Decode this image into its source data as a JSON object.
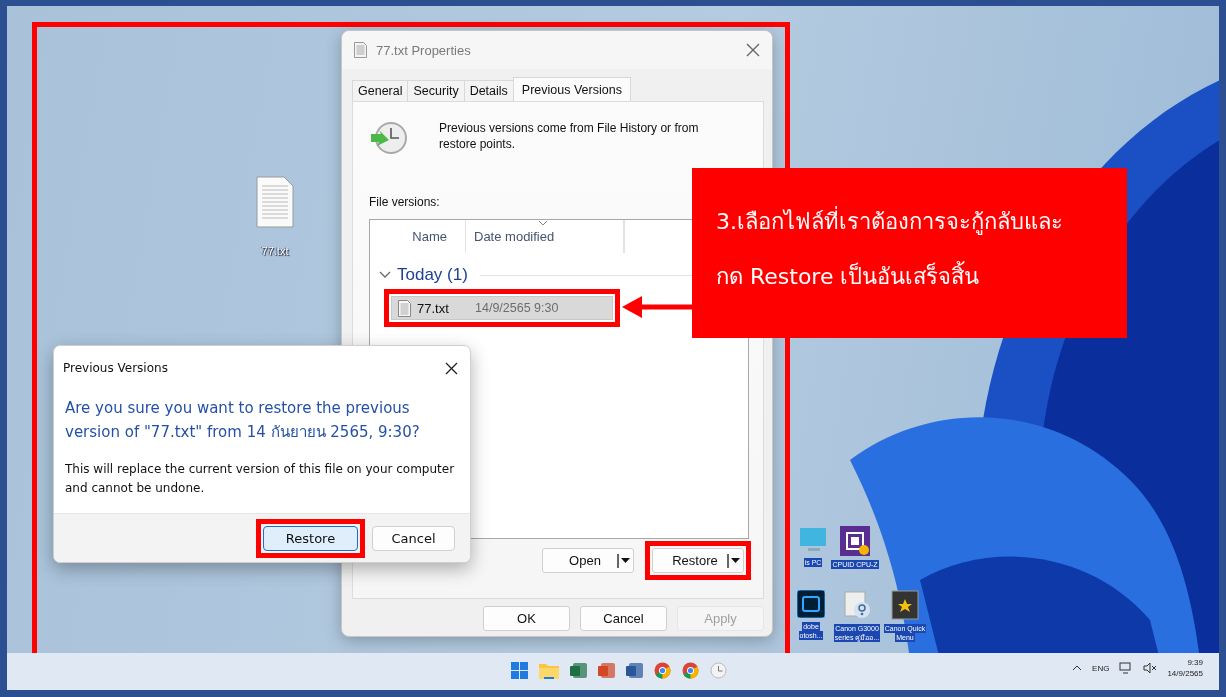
{
  "desktop": {
    "icons": [
      {
        "kind": "text-file",
        "lines": [
          "77.txt"
        ]
      },
      {
        "kind": "monitor",
        "lines": [
          "is PC"
        ]
      },
      {
        "kind": "cpu-app",
        "lines": [
          "CPUID CPU-Z"
        ]
      },
      {
        "kind": "ps-app",
        "lines": [
          "dobe",
          "otosh..."
        ]
      },
      {
        "kind": "help-app",
        "lines": [
          "Canon G3000",
          "series คู่มืออ..."
        ]
      },
      {
        "kind": "canon-app",
        "lines": [
          "Canon Quick",
          "Menu"
        ]
      }
    ]
  },
  "properties_window": {
    "title": "77.txt Properties",
    "tabs": [
      {
        "label": "General",
        "selected": false
      },
      {
        "label": "Security",
        "selected": false
      },
      {
        "label": "Details",
        "selected": false
      },
      {
        "label": "Previous Versions",
        "selected": true
      }
    ],
    "info": "Previous versions come from File History or from restore points.",
    "list_label": "File versions:",
    "columns": [
      {
        "label": "Name",
        "sorted": false
      },
      {
        "label": "Date modified",
        "sorted": true
      }
    ],
    "group": {
      "label": "Today (1)",
      "expanded": true,
      "rows": [
        {
          "name": "77.txt",
          "date": "14/9/2565 9:30",
          "selected": true,
          "highlighted": true
        }
      ]
    },
    "split_buttons": [
      {
        "label": "Open",
        "highlighted": false
      },
      {
        "label": "Restore",
        "highlighted": true
      }
    ],
    "buttons": [
      {
        "label": "OK",
        "disabled": false
      },
      {
        "label": "Cancel",
        "disabled": false
      },
      {
        "label": "Apply",
        "disabled": true
      }
    ]
  },
  "confirm_dialog": {
    "title": "Previous Versions",
    "question": "Are you sure you want to restore the previous version of \"77.txt\" from 14 กันยายน 2565, 9:30?",
    "detail": "This will replace the current version of this file on your computer and cannot be undone.",
    "buttons": [
      {
        "label": "Restore",
        "default": true,
        "highlighted": true
      },
      {
        "label": "Cancel",
        "default": false,
        "highlighted": false
      }
    ]
  },
  "callout": {
    "lines": [
      "3.เลือกไฟล์ที่เราต้องการจะกู้กลับและ",
      "กด Restore เป็นอันเสร็จสิ้น"
    ]
  },
  "taskbar": {
    "apps": [
      {
        "kind": "start"
      },
      {
        "kind": "folder"
      },
      {
        "kind": "excel"
      },
      {
        "kind": "powerpoint"
      },
      {
        "kind": "word"
      },
      {
        "kind": "chrome"
      },
      {
        "kind": "chrome"
      },
      {
        "kind": "clock"
      }
    ],
    "language": "ENG",
    "time": "9:39",
    "date": "14/9/2565"
  }
}
